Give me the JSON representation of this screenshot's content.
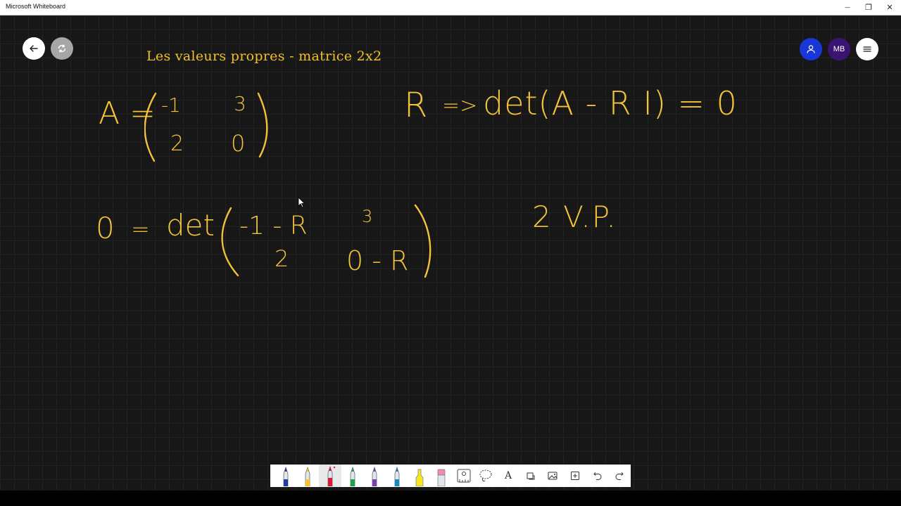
{
  "window": {
    "title": "Microsoft Whiteboard",
    "minimize_icon": "—",
    "restore_icon": "❐",
    "close_icon": "✕"
  },
  "board": {
    "title": "Les valeurs propres - matrice 2x2",
    "user_initials": "MB"
  },
  "ink": {
    "matrix_lhs": "A =",
    "m11": "-1",
    "m12": "3",
    "m21": "2",
    "m22": "0",
    "lambda": "R",
    "implies": "=>",
    "det_expr": "det(A - R I) = 0",
    "eq_lhs": "0",
    "eq_equals": "=",
    "eq_det": "det",
    "d11": "-1 - R",
    "d12": "3",
    "d21": "2",
    "d22": "0 - R",
    "note": "2 V.P."
  },
  "toolbar": {
    "tools": [
      {
        "name": "pen-blue",
        "color": "#1f3d9a"
      },
      {
        "name": "pen-yellow",
        "color": "#f2c230"
      },
      {
        "name": "pen-red",
        "color": "#d8193a"
      },
      {
        "name": "pen-green",
        "color": "#1aa34a"
      },
      {
        "name": "pen-purple",
        "color": "#7a3fb0"
      },
      {
        "name": "pen-teal",
        "color": "#178bbd"
      },
      {
        "name": "highlighter-yellow",
        "color": "#f7e623"
      },
      {
        "name": "eraser",
        "color": "#f08ab8"
      }
    ],
    "text_tool_label": "A"
  },
  "colors": {
    "ink": "#f2c33a",
    "canvas": "#171717",
    "user_avatar": "#1a36d6",
    "initials_avatar": "#3a1470"
  }
}
